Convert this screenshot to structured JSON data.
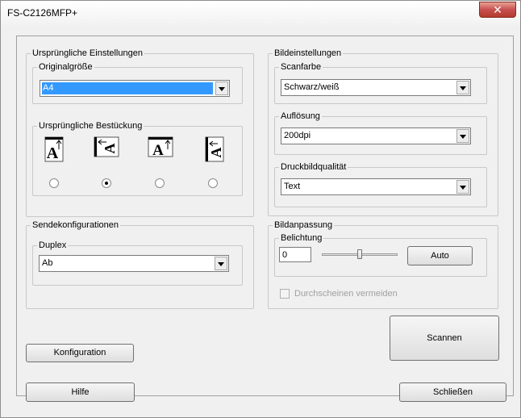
{
  "window": {
    "title": "FS-C2126MFP+",
    "close_glyph": "✕"
  },
  "original_settings": {
    "legend": "Ursprüngliche Einstellungen",
    "original_size": {
      "legend": "Originalgröße",
      "value": "A4"
    },
    "placement": {
      "legend": "Ursprüngliche Bestückung",
      "options": [
        {
          "icon": "portrait-top-edge-icon",
          "checked": false
        },
        {
          "icon": "portrait-left-edge-icon",
          "checked": true
        },
        {
          "icon": "landscape-top-edge-icon",
          "checked": false
        },
        {
          "icon": "landscape-left-edge-icon",
          "checked": false
        }
      ],
      "glyph": "A"
    }
  },
  "send_config": {
    "legend": "Sendekonfigurationen",
    "duplex": {
      "legend": "Duplex",
      "value": "Ab"
    }
  },
  "image_settings": {
    "legend": "Bildeinstellungen",
    "scan_color": {
      "legend": "Scanfarbe",
      "value": "Schwarz/weiß"
    },
    "resolution": {
      "legend": "Auflösung",
      "value": "200dpi"
    },
    "quality": {
      "legend": "Druckbildqualität",
      "value": "Text"
    }
  },
  "image_adjust": {
    "legend": "Bildanpassung",
    "exposure": {
      "legend": "Belichtung",
      "value": "0",
      "auto_label": "Auto",
      "slider_level": 0.5
    },
    "bleed_through": {
      "label": "Durchscheinen vermeiden",
      "checked": false,
      "disabled": true
    }
  },
  "buttons": {
    "scan": "Scannen",
    "configuration": "Konfiguration",
    "help": "Hilfe",
    "close": "Schließen"
  },
  "colors": {
    "selection": "#3399ff",
    "close_button": "#c75050"
  }
}
